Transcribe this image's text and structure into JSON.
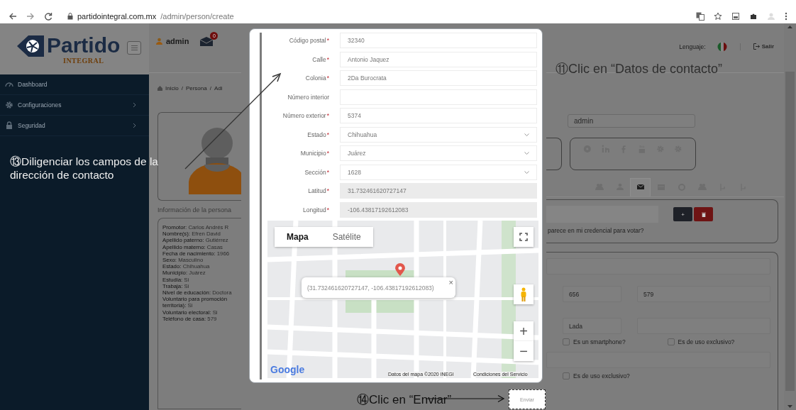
{
  "browser": {
    "url_host": "partidointegral.com.mx",
    "url_path": "/admin/person/create"
  },
  "sidebar": {
    "logo_main": "Partido",
    "logo_sub": "INTEGRAL",
    "items": [
      {
        "label": "Dashboard",
        "expandable": false
      },
      {
        "label": "Configuraciones",
        "expandable": true
      },
      {
        "label": "Seguridad",
        "expandable": true
      }
    ]
  },
  "header": {
    "user": "admin",
    "mail_count": "0",
    "language_label": "Lenguaje:",
    "logout": "Salir"
  },
  "breadcrumb": [
    {
      "label": "Inicio"
    },
    {
      "separator": "/",
      "label": "Persona"
    },
    {
      "separator": "/",
      "label": "Adi"
    }
  ],
  "person_info": {
    "title": "Información de la persona",
    "lines": [
      {
        "label": "Promotor:",
        "value": "Carlos Andrés R"
      },
      {
        "label": "Nombre(s):",
        "value": "Efren David"
      },
      {
        "label": "Apellido paterno:",
        "value": "Gutiérrez"
      },
      {
        "label": "Apellido materno:",
        "value": "Casas"
      },
      {
        "label": "Fecha de nacimiento:",
        "value": "1966"
      },
      {
        "label": "Sexo:",
        "value": "Masculino"
      },
      {
        "label": "Estado:",
        "value": "Chihuahua"
      },
      {
        "label": "Municipio:",
        "value": "Juárez"
      },
      {
        "label": "Estudia:",
        "value": "Si"
      },
      {
        "label": "Trabaja:",
        "value": "Si"
      },
      {
        "label": "Nivel de educación:",
        "value": "Doctora"
      },
      {
        "label": "Voluntario para promoción territoria):",
        "value": "Si"
      },
      {
        "label": "Voluntario electoral:",
        "value": "Si"
      },
      {
        "label": "Teléfono de casa:",
        "value": "579"
      }
    ]
  },
  "account": {
    "username": "admin"
  },
  "tabs": [
    {
      "selected": false
    },
    {
      "selected": false
    },
    {
      "selected": true
    },
    {
      "selected": false
    },
    {
      "selected": false
    },
    {
      "selected": false
    },
    {
      "selected": false
    },
    {
      "selected": false
    }
  ],
  "credential_card": {
    "add_label": "+",
    "note": "parece en mi credencial para votar?"
  },
  "phones": {
    "area_code": "656",
    "number": "579",
    "lada_placeholder": "Lada",
    "checks_row": [
      {
        "label": "Es un smartphone?",
        "checked": false
      },
      {
        "label": "Es de uso exclusivo?",
        "checked": false
      }
    ],
    "checks_bottom": [
      {
        "label": "Es de uso exclusivo?",
        "checked": false
      }
    ]
  },
  "modal": {
    "fields": [
      {
        "label": "Código postal",
        "mark": "*",
        "kind": "text",
        "value": "32340"
      },
      {
        "label": "Calle",
        "mark": "*",
        "kind": "text",
        "value": "Antonio Jaquez"
      },
      {
        "label": "Colonia",
        "mark": "*",
        "kind": "text",
        "value": "2Da Burocrata"
      },
      {
        "label": "Número interior",
        "kind": "text"
      },
      {
        "label": "Número exterior",
        "mark": "*",
        "kind": "text",
        "value": "5374"
      },
      {
        "label": "Estado",
        "mark": "*",
        "kind": "select",
        "value": "Chihuahua"
      },
      {
        "label": "Municipio",
        "mark": "*",
        "kind": "select",
        "value": "Juárez"
      },
      {
        "label": "Sección",
        "mark": "*",
        "kind": "select",
        "value": "1628"
      },
      {
        "label": "Latitud",
        "mark": "*",
        "kind": "readonly",
        "value": "31.732461620727147"
      },
      {
        "label": "Longitud",
        "mark": "*",
        "kind": "readonly",
        "value": "-106.43817192612083"
      }
    ],
    "map": {
      "map_types": [
        {
          "label": "Mapa",
          "selected": true
        },
        {
          "label": "Satélite",
          "selected": false
        }
      ],
      "popup": "(31.732461620727147, -106.43817192612083)",
      "popup_close": "×",
      "zoom_in": "+",
      "zoom_out": "−",
      "logo": "Google",
      "attribution": "Datos del mapa ©2020 INEGI",
      "terms": "Condiciones del Servicio"
    }
  },
  "submit_button": "Enviar",
  "annotations": {
    "fill_fields": "⑬Diligenciar los campos de la dirección de contacto",
    "contact_tab": "⑪Clic en “Datos de contacto”",
    "submit": "⑭Clic en “Enviar”"
  }
}
